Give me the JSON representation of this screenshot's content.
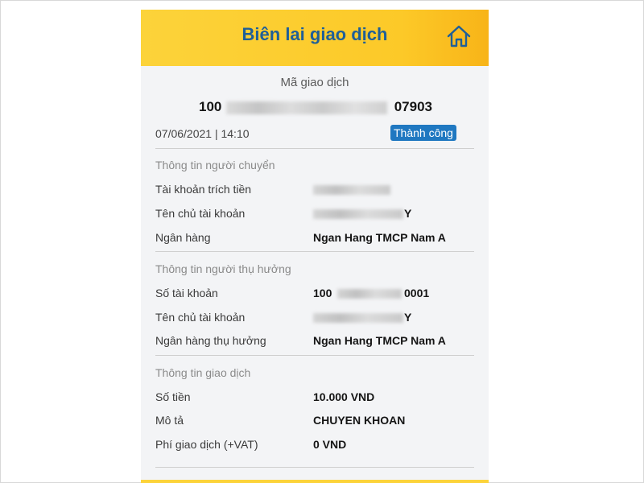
{
  "header": {
    "title": "Biên lai giao dịch"
  },
  "transaction": {
    "code_label": "Mã giao dịch",
    "code_prefix": "100",
    "code_suffix": "07903",
    "datetime": "07/06/2021 | 14:10",
    "status": "Thành công"
  },
  "sender": {
    "section_title": "Thông tin người chuyển",
    "account_label": "Tài khoản trích tiền",
    "owner_label": "Tên chủ tài khoản",
    "owner_suffix": "Y",
    "bank_label": "Ngân hàng",
    "bank_value": "Ngan Hang TMCP Nam A"
  },
  "beneficiary": {
    "section_title": "Thông tin người thụ hưởng",
    "account_label": "Số tài khoản",
    "account_prefix": "100",
    "account_suffix": "0001",
    "owner_label": "Tên chủ tài khoản",
    "owner_suffix": "Y",
    "bank_label": "Ngân hàng thụ hưởng",
    "bank_value": "Ngan Hang TMCP Nam A"
  },
  "details": {
    "section_title": "Thông tin giao dịch",
    "amount_label": "Số tiền",
    "amount_value": "10.000 VND",
    "description_label": "Mô tả",
    "description_value": "CHUYEN KHOAN",
    "fee_label": "Phí giao dịch (+VAT)",
    "fee_value": "0 VND"
  },
  "colors": {
    "header_bg": "#fcd33a",
    "title_blue": "#1f5f98",
    "status_bg": "#1f78c1"
  },
  "icons": {
    "home": "home-icon"
  }
}
